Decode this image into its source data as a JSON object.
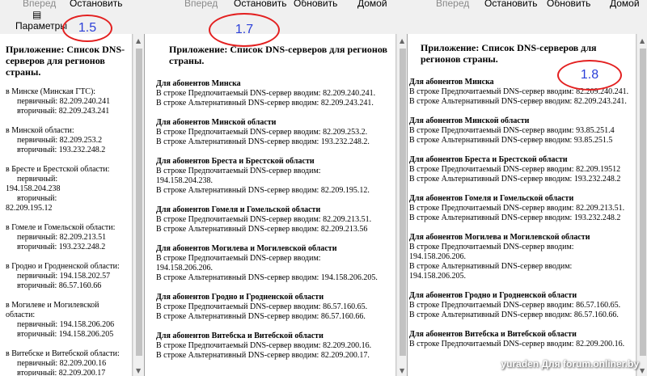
{
  "pane1": {
    "toolbar": {
      "forward": "Вперед",
      "stop": "Остановить",
      "params": "Параметры"
    },
    "title": "Приложение: Список DNS-серверов для регионов страны.",
    "sections": [
      {
        "head": "в Минске (Минская ГТС):",
        "lines": [
          "первичный: 82.209.240.241",
          "вторичный: 82.209.243.241"
        ]
      },
      {
        "head": "в Минской области:",
        "lines": [
          "первичный: 82.209.253.2",
          "вторичный: 193.232.248.2"
        ]
      },
      {
        "head": "в Бресте и Брестской области:",
        "lines": [
          "первичный:",
          "194.158.204.238",
          "вторичный:",
          "82.209.195.12"
        ]
      },
      {
        "head": "в Гомеле и Гомельской области:",
        "lines": [
          "первичный: 82.209.213.51",
          "вторичный: 193.232.248.2"
        ]
      },
      {
        "head": "в Гродно и Гродненской области:",
        "lines": [
          "первичный: 194.158.202.57",
          "вторичный: 86.57.160.66"
        ]
      },
      {
        "head": "в Могилеве и Могилевской области:",
        "lines": [
          "первичный: 194.158.206.206",
          "вторичный: 194.158.206.205"
        ]
      },
      {
        "head": "в Витебске и Витебской области:",
        "lines": [
          "первичный: 82.209.200.16",
          "вторичный: 82.209.200.17"
        ]
      }
    ]
  },
  "pane2": {
    "toolbar": {
      "forward": "Вперед",
      "stop": "Остановить",
      "refresh": "Обновить",
      "home": "Домой"
    },
    "title": "Приложение: Список DNS-серверов для регионов страны.",
    "sections": [
      {
        "head": "Для абонентов Минска",
        "lines": [
          "В строке Предпочитаемый DNS-сервер вводим: 82.209.240.241.",
          "В строке Альтернативный DNS-сервер вводим: 82.209.243.241."
        ]
      },
      {
        "head": "Для абонентов Минской области",
        "lines": [
          "В строке Предпочитаемый DNS-сервер вводим: 82.209.253.2.",
          "В строке Альтернативный DNS-сервер вводим: 193.232.248.2."
        ]
      },
      {
        "head": "Для абонентов Бреста и Брестской области",
        "lines": [
          "В строке Предпочитаемый DNS-сервер вводим:",
          "194.158.204.238.",
          "В строке Альтернативный DNS-сервер вводим: 82.209.195.12."
        ]
      },
      {
        "head": "Для абонентов Гомеля и Гомельской области",
        "lines": [
          "В строке Предпочитаемый DNS-сервер вводим: 82.209.213.51.",
          "В строке Альтернативный DNS-сервер вводим: 82.209.213.56"
        ]
      },
      {
        "head": "Для абонентов Могилева и Могилевской области",
        "lines": [
          "В строке Предпочитаемый DNS-сервер вводим:",
          "194.158.206.206.",
          "В строке Альтернативный DNS-сервер вводим: 194.158.206.205."
        ]
      },
      {
        "head": "Для абонентов Гродно и Гродненской области",
        "lines": [
          "В строке Предпочитаемый DNS-сервер вводим: 86.57.160.65.",
          "В строке Альтернативный DNS-сервер вводим: 86.57.160.66."
        ]
      },
      {
        "head": "Для абонентов Витебска и Витебской области",
        "lines": [
          "В строке Предпочитаемый DNS-сервер вводим: 82.209.200.16.",
          "В строке Альтернативный DNS-сервер вводим: 82.209.200.17."
        ]
      }
    ]
  },
  "pane3": {
    "toolbar": {
      "forward": "Вперед",
      "stop": "Остановить",
      "refresh": "Обновить",
      "home": "Домой"
    },
    "title": "Приложение: Список DNS-серверов для регионов страны.",
    "sections": [
      {
        "head": "Для абонентов Минска",
        "lines": [
          "В строке Предпочитаемый DNS-сервер вводим: 82.209.240.241.",
          "В строке Альтернативный DNS-сервер вводим: 82.209.243.241."
        ]
      },
      {
        "head": "Для абонентов Минской области",
        "lines": [
          "В строке Предпочитаемый DNS-сервер вводим: 93.85.251.4",
          "В строке Альтернативный DNS-сервер вводим: 93.85.251.5"
        ]
      },
      {
        "head": "Для абонентов Бреста и Брестской области",
        "lines": [
          "В строке Предпочитаемый DNS-сервер вводим: 82.209.19512",
          "В строке Альтернативный DNS-сервер вводим: 193.232.248.2"
        ]
      },
      {
        "head": "Для абонентов Гомеля и Гомельской области",
        "lines": [
          "В строке Предпочитаемый DNS-сервер вводим: 82.209.213.51.",
          "В строке Альтернативный DNS-сервер вводим: 193.232.248.2"
        ]
      },
      {
        "head": "Для абонентов  Могилева и Могилевской области",
        "lines": [
          "В строке Предпочитаемый DNS-сервер вводим:",
          "194.158.206.206.",
          "В строке Альтернативный DNS-сервер вводим:",
          "194.158.206.205."
        ]
      },
      {
        "head": "Для абонентов  Гродно и Гродненской области",
        "lines": [
          "В строке Предпочитаемый DNS-сервер вводим: 86.57.160.65.",
          "В строке Альтернативный DNS-сервер вводим: 86.57.160.66."
        ]
      },
      {
        "head": "Для абонентов  Витебска и Витебской области",
        "lines": [
          "В строке Предпочитаемый DNS-сервер вводим: 82.209.200.16."
        ]
      }
    ]
  },
  "annotations": {
    "a1": "1.5",
    "a2": "1.7",
    "a3": "1.8"
  },
  "watermark": "yuraden Для forum.onliner.by",
  "colors": {
    "annotation_ring": "#e32020",
    "annotation_text": "#2b3fd8"
  },
  "icons": {
    "params": "settings-sheet-icon",
    "scroll_up": "scroll-up-arrow-icon",
    "scroll_down": "scroll-down-arrow-icon"
  }
}
